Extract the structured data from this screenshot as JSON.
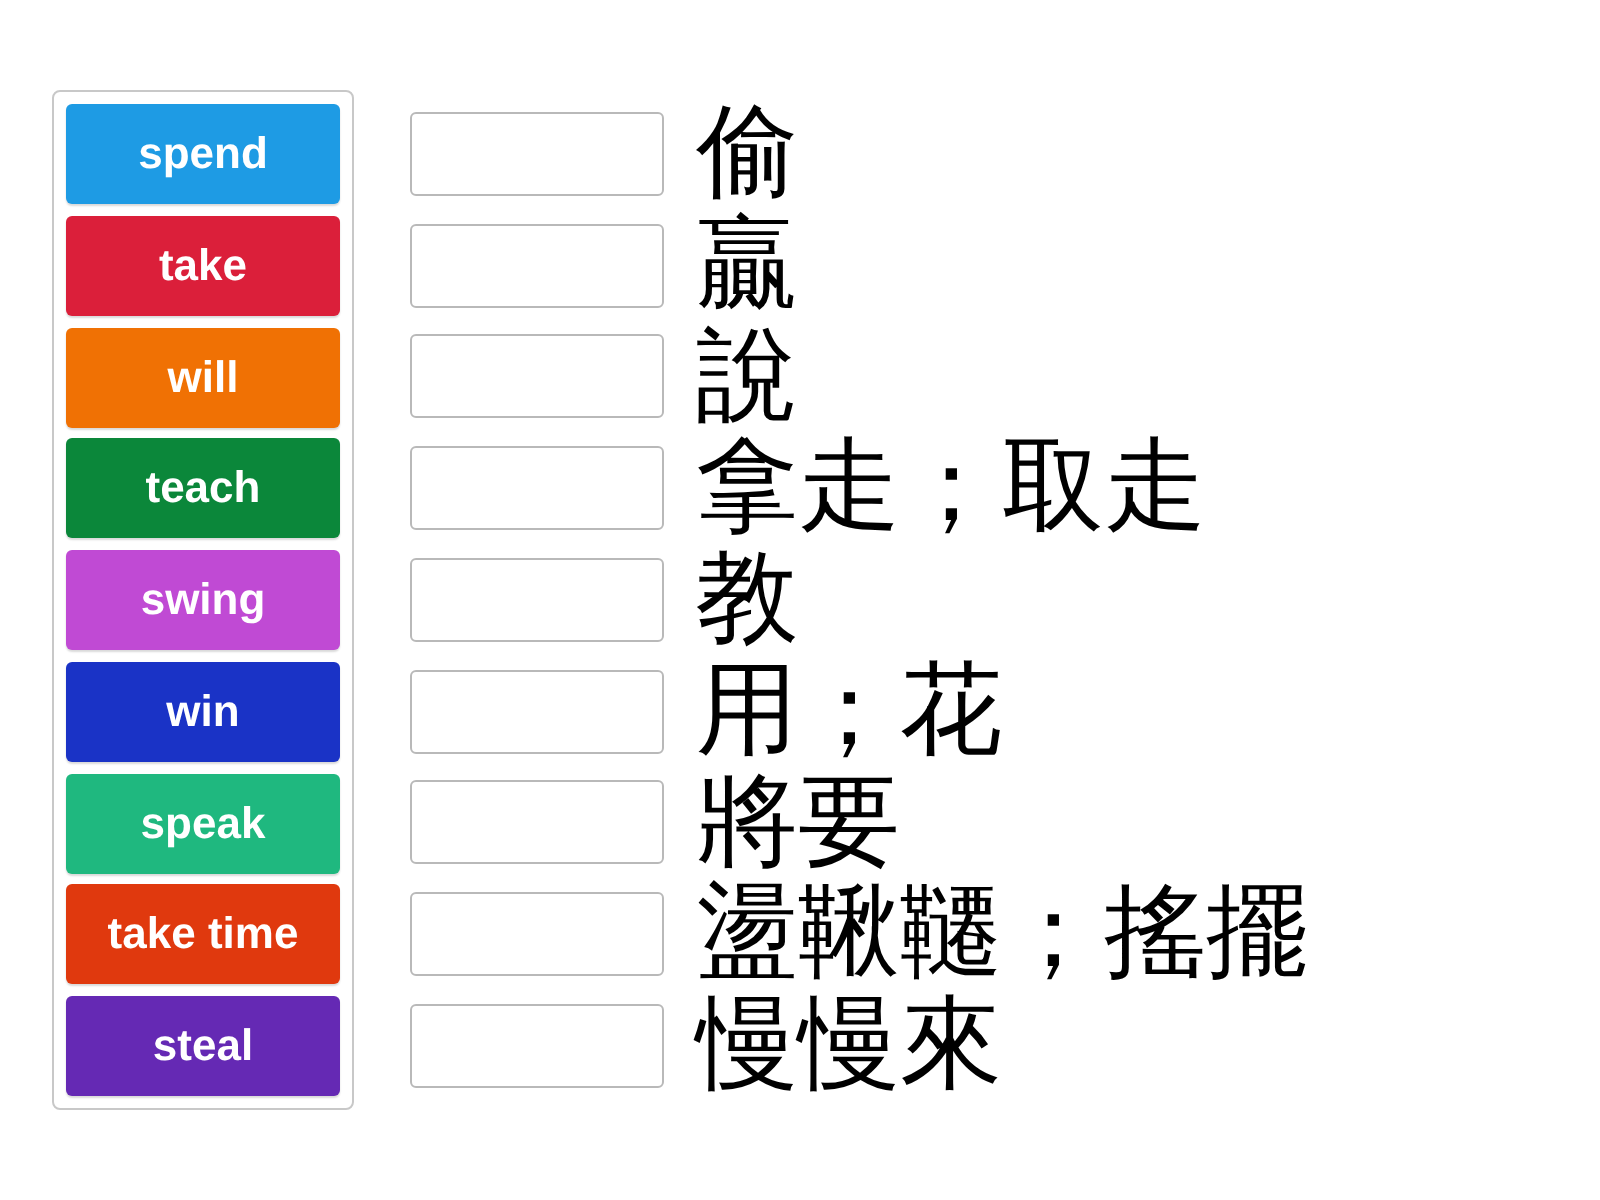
{
  "tiles": [
    {
      "label": "spend",
      "color": "#1e9be4"
    },
    {
      "label": "take",
      "color": "#db1f3a"
    },
    {
      "label": "will",
      "color": "#f07104"
    },
    {
      "label": "teach",
      "color": "#0b873a"
    },
    {
      "label": "swing",
      "color": "#c04ad4"
    },
    {
      "label": "win",
      "color": "#1a33c6"
    },
    {
      "label": "speak",
      "color": "#1fb87f"
    },
    {
      "label": "take time",
      "color": "#e0390e"
    },
    {
      "label": "steal",
      "color": "#6529b4"
    }
  ],
  "targets": [
    {
      "text": "偷"
    },
    {
      "text": "贏"
    },
    {
      "text": "說"
    },
    {
      "text": "拿走；取走"
    },
    {
      "text": "教"
    },
    {
      "text": "用；花"
    },
    {
      "text": "將要"
    },
    {
      "text": "盪鞦韆；搖擺"
    },
    {
      "text": "慢慢來"
    }
  ]
}
